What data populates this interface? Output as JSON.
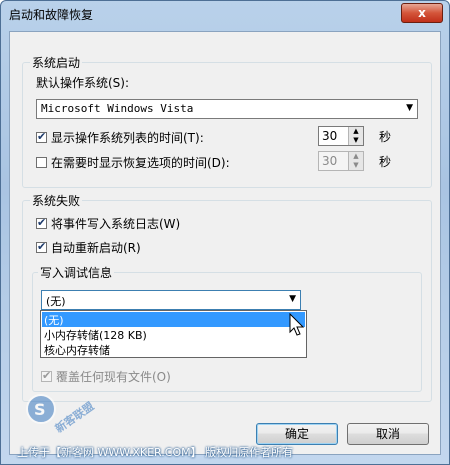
{
  "window": {
    "title": "启动和故障恢复",
    "close_label": "x"
  },
  "startup": {
    "group_label": "系统启动",
    "default_os_label": "默认操作系统(S):",
    "default_os_value": "Microsoft Windows Vista",
    "show_os_list": {
      "label": "显示操作系统列表的时间(T):",
      "checked": true,
      "value": "30",
      "unit": "秒"
    },
    "show_recovery": {
      "label": "在需要时显示恢复选项的时间(D):",
      "checked": false,
      "value": "30",
      "unit": "秒"
    }
  },
  "failure": {
    "group_label": "系统失败",
    "write_event": {
      "label": "将事件写入系统日志(W)",
      "checked": true
    },
    "auto_restart": {
      "label": "自动重新启动(R)",
      "checked": true
    },
    "debug_group_label": "写入调试信息",
    "debug_selected": "(无)",
    "debug_options": [
      "(无)",
      "小内存转储(128 KB)",
      "核心内存转储"
    ],
    "overwrite": {
      "label": "覆盖任何现有文件(O)",
      "checked": true
    }
  },
  "buttons": {
    "ok": "确定",
    "cancel": "取消"
  },
  "watermark": {
    "text": "上传于【新客网 WWW.XKER.COM】 版权归原作者所有",
    "logo_text": "新客联盟"
  },
  "colors": {
    "selection": "#3399ff",
    "title_bg": "#b9d1ea",
    "close_red": "#c0301a"
  }
}
